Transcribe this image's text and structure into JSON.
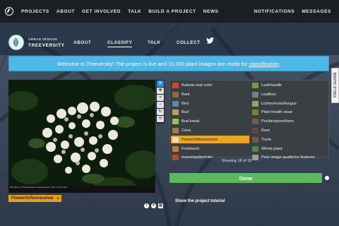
{
  "nav": {
    "links": [
      "PROJECTS",
      "ABOUT",
      "GET INVOLVED",
      "TALK",
      "BUILD A PROJECT",
      "NEWS"
    ],
    "right": [
      "NOTIFICATIONS",
      "MESSAGES"
    ]
  },
  "project": {
    "org": "URBAN SENSOR",
    "title": "TREEVERSITY",
    "tabs": [
      "ABOUT",
      "CLASSIFY",
      "TALK",
      "COLLECT"
    ],
    "active_tab": "CLASSIFY"
  },
  "banner": {
    "text": "Welcome to Treeversity! The project is live and 10,000 plant images are ready for ",
    "link": "classification",
    "end": "."
  },
  "field_guide": "FIELD GUIDE",
  "subject": {
    "caption": "Kirk Moore | Photographer contribution EIL 2014 | CC-BY-NC",
    "selected_label": "Flower/inflorescence",
    "remove_icon": "x"
  },
  "tools": [
    "pointer",
    "move",
    "zoom-in",
    "zoom-out",
    "rotate",
    "reset"
  ],
  "choices": [
    {
      "label": "Autumn leaf color",
      "color": "#c44c2a",
      "selected": false
    },
    {
      "label": "Leaf/needle",
      "color": "#6aa23a",
      "selected": false
    },
    {
      "label": "Bark",
      "color": "#8a6a4a",
      "selected": false
    },
    {
      "label": "Leafless",
      "color": "#7f7f7f",
      "selected": false
    },
    {
      "label": "Bird",
      "color": "#5d88b3",
      "selected": false
    },
    {
      "label": "Lichen/moss/fungus",
      "color": "#91a85a",
      "selected": false
    },
    {
      "label": "Bud",
      "color": "#b9a35a",
      "selected": false
    },
    {
      "label": "Plant health issue",
      "color": "#6b8b2e",
      "selected": false
    },
    {
      "label": "Bud break",
      "color": "#9cbf58",
      "selected": false
    },
    {
      "label": "Prickle/spine/thorn",
      "color": "#7a5a40",
      "selected": false
    },
    {
      "label": "Cone",
      "color": "#a07a50",
      "selected": false
    },
    {
      "label": "Root",
      "color": "#5f4a36",
      "selected": false
    },
    {
      "label": "Flower/inflorescence",
      "color": "#e5d9c8",
      "selected": true
    },
    {
      "label": "Trunk",
      "color": "#6e5a48",
      "selected": false
    },
    {
      "label": "Fruit/seed",
      "color": "#c67a3a",
      "selected": false
    },
    {
      "label": "Whole plant",
      "color": "#4f8a3c",
      "selected": false
    },
    {
      "label": "Insect/spider/mite",
      "color": "#a6552a",
      "selected": false
    },
    {
      "label": "Poor image quality/no features",
      "color": "#9a9a9a",
      "selected": false
    }
  ],
  "showing": "Showing 18 of 18",
  "done_label": "Done",
  "tutorial_link": "Show the project tutorial",
  "colors": {
    "banner": "#4fb6e8",
    "done": "#5cb85c",
    "selected": "#e7a822"
  }
}
